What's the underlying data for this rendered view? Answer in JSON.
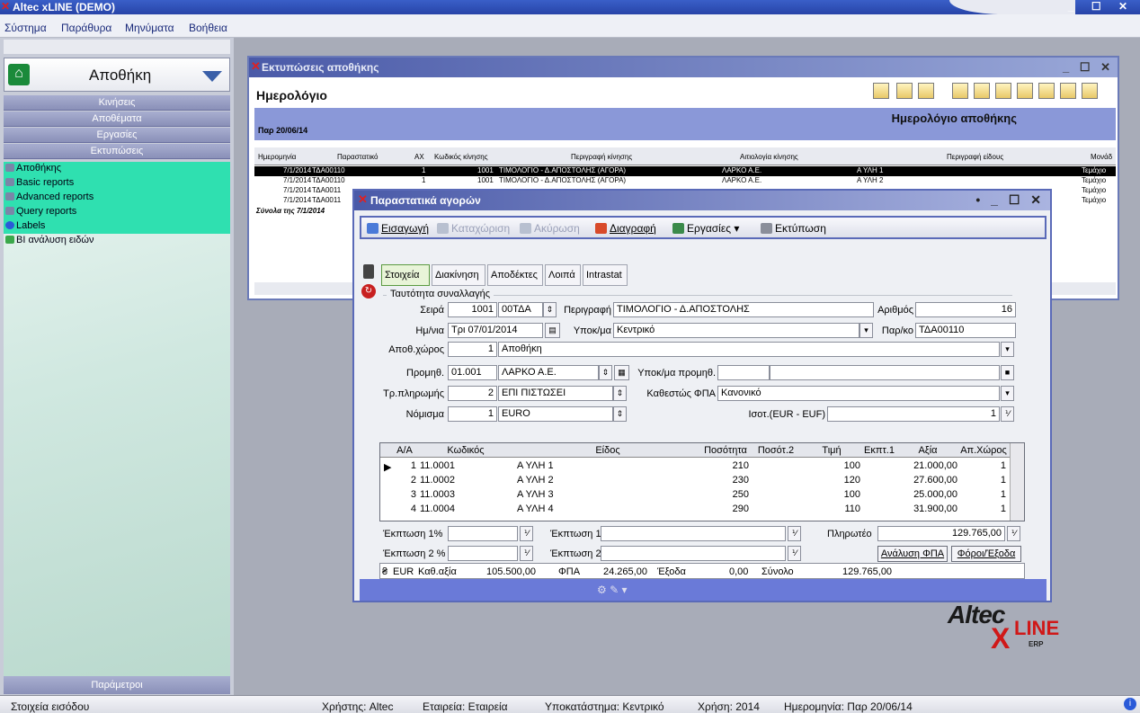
{
  "app": {
    "title": "Altec xLINE (DEMO)",
    "window_controls": "_ ☐ ✕"
  },
  "menu": [
    "Σύστημα",
    "Παράθυρα",
    "Μηνύματα",
    "Βοήθεια"
  ],
  "left_panel": {
    "title": "Αποθήκη",
    "sections": [
      "Κινήσεις",
      "Αποθέματα",
      "Εργασίες",
      "Εκτυπώσεις"
    ],
    "items": [
      "Αποθήκης",
      "Basic reports",
      "Advanced reports",
      "Query reports",
      "Labels",
      "BI ανάλυση ειδών"
    ],
    "bottom": "Παράμετροι"
  },
  "reports_window": {
    "title": "Εκτυπώσεις αποθήκης",
    "heading": "Ημερολόγιο",
    "report_title": "Ημερολόγιο αποθήκης",
    "date": "Παρ 20/06/14",
    "columns": [
      "Ημερομηνία",
      "Παραστατικό",
      "ΑΧ",
      "Κωδικός κίνησης",
      "Περιγραφή κίνησης",
      "Αιτιολογία κίνησης",
      "Περιγραφή είδους",
      "Μονάδ"
    ],
    "rows": [
      {
        "date": "7/1/2014",
        "doc": "ΤΔΑ00110",
        "ax": "1",
        "code": "1001",
        "desc": "ΤΙΜΟΛΟΓΙΟ - Δ.ΑΠΟΣΤΟΛΗΣ (ΑΓΟΡΑ)",
        "reason": "ΛΑΡΚΟ Α.Ε.",
        "item": "Α ΥΛΗ 1",
        "unit": "Τεμάχιο"
      },
      {
        "date": "7/1/2014",
        "doc": "ΤΔΑ00110",
        "ax": "1",
        "code": "1001",
        "desc": "ΤΙΜΟΛΟΓΙΟ - Δ.ΑΠΟΣΤΟΛΗΣ (ΑΓΟΡΑ)",
        "reason": "ΛΑΡΚΟ Α.Ε.",
        "item": "Α ΥΛΗ 2",
        "unit": "Τεμάχιο"
      },
      {
        "date": "7/1/2014",
        "doc": "ΤΔΑ0011",
        "ax": "",
        "code": "",
        "desc": "",
        "reason": "",
        "item": "",
        "unit": "Τεμάχιο"
      },
      {
        "date": "7/1/2014",
        "doc": "ΤΔΑ0011",
        "ax": "",
        "code": "",
        "desc": "",
        "reason": "",
        "item": "",
        "unit": "Τεμάχιο"
      }
    ],
    "totals_label": "Σύνολα της 7/1/2014"
  },
  "dialog": {
    "title": "Παραστατικά αγορών",
    "toolbar": {
      "insert": "Εισαγωγή",
      "post": "Καταχώριση",
      "cancel": "Ακύρωση",
      "delete": "Διαγραφή",
      "tasks": "Εργασίες",
      "print": "Εκτύπωση"
    },
    "tabs": [
      "Στοιχεία",
      "Διακίνηση",
      "Αποδέκτες",
      "Λοιπά",
      "Intrastat"
    ],
    "group": "Ταυτότητα συναλλαγής",
    "fields": {
      "seira_label": "Σειρά",
      "seira_num": "1001",
      "seira_code": "00ΤΔΑ",
      "perigrafi_label": "Περιγραφή",
      "perigrafi": "ΤΙΜΟΛΟΓΙΟ - Δ.ΑΠΟΣΤΟΛΗΣ",
      "arithmos_label": "Αριθμός",
      "arithmos": "16",
      "date_label": "Ημ/νια",
      "date": "Τρι 07/01/2014",
      "ypokma_label": "Υποκ/μα",
      "ypokma": "Κεντρικό",
      "parko_label": "Παρ/κο",
      "parko": "ΤΔΑ00110",
      "apoth_label": "Αποθ.χώρος",
      "apoth_num": "1",
      "apoth": "Αποθήκη",
      "prom_label": "Προμηθ.",
      "prom_code": "01.001",
      "prom": "ΛΑΡΚΟ Α.Ε.",
      "ypokprom_label": "Υποκ/μα προμηθ.",
      "trpl_label": "Τρ.πληρωμής",
      "trpl_num": "2",
      "trpl": "ΕΠΙ ΠΙΣΤΩΣΕΙ",
      "fpa_label": "Καθεστώς ΦΠΑ",
      "fpa": "Κανονικό",
      "nomisma_label": "Νόμισμα",
      "nomisma_num": "1",
      "nomisma": "EURO",
      "isot_label": "Ισοτ.(EUR - EUF)",
      "isot": "1"
    },
    "grid": {
      "columns": [
        "Α/Α",
        "Κωδικός",
        "Είδος",
        "Ποσότητα",
        "Ποσότ.2",
        "Τιμή",
        "Εκπτ.1",
        "Αξία",
        "Απ.Χώρος"
      ],
      "rows": [
        {
          "aa": "1",
          "code": "11.0001",
          "item": "Α ΥΛΗ 1",
          "qty": "210",
          "price": "100",
          "value": "21.000,00",
          "store": "1"
        },
        {
          "aa": "2",
          "code": "11.0002",
          "item": "Α ΥΛΗ 2",
          "qty": "230",
          "price": "120",
          "value": "27.600,00",
          "store": "1"
        },
        {
          "aa": "3",
          "code": "11.0003",
          "item": "Α ΥΛΗ 3",
          "qty": "250",
          "price": "100",
          "value": "25.000,00",
          "store": "1"
        },
        {
          "aa": "4",
          "code": "11.0004",
          "item": "Α ΥΛΗ 4",
          "qty": "290",
          "price": "110",
          "value": "31.900,00",
          "store": "1"
        }
      ]
    },
    "discount1_label": "Έκπτωση 1%",
    "discount2_label": "Έκπτωση 2 %",
    "ekptosi1_label": "Έκπτωση 1",
    "ekptosi2_label": "Έκπτωση 2",
    "pliroteo_label": "Πληρωτέο",
    "pliroteo": "129.765,00",
    "analysis_btn": "Ανάλυση ΦΠΑ",
    "taxes_btn": "Φόροι/Έξοδα",
    "totals": {
      "currency": "EUR",
      "kath_label": "Καθ.αξία",
      "kath": "105.500,00",
      "fpa_label": "ΦΠΑ",
      "fpa": "24.265,00",
      "exoda_label": "Έξοδα",
      "exoda": "0,00",
      "synolo_label": "Σύνολο",
      "synolo": "129.765,00"
    }
  },
  "logo": {
    "altec": "Altec",
    "x": "X",
    "line": "LINE",
    "erp": "ERP"
  },
  "status": {
    "left": "Στοιχεία εισόδου",
    "user": "Χρήστης: Altec",
    "company": "Εταιρεία: Εταιρεία",
    "branch": "Υποκατάστημα: Κεντρικό",
    "year": "Χρήση: 2014",
    "date": "Ημερομηνία: Παρ 20/06/14"
  }
}
